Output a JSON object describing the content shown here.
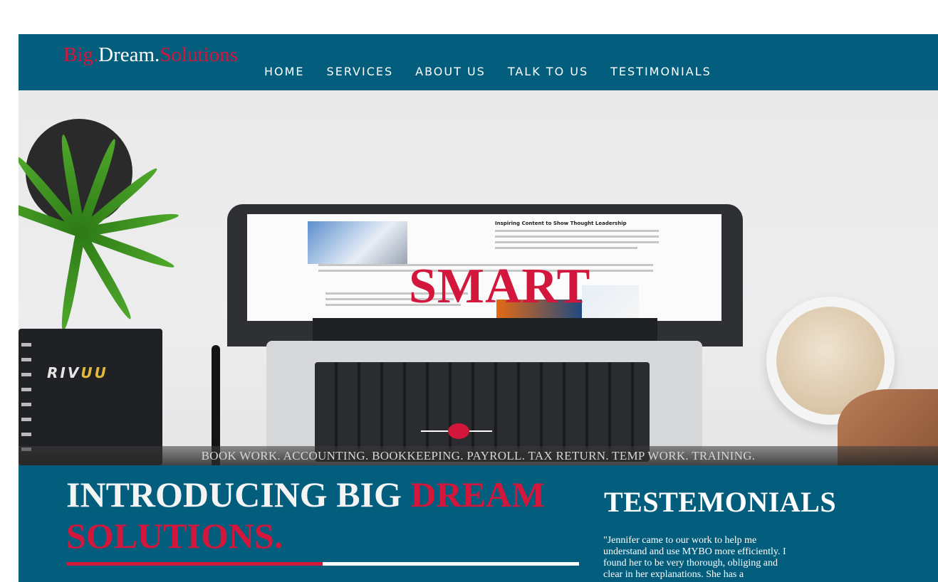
{
  "logo": {
    "part1": "Big.",
    "part2": "Dream.",
    "part3": "Solutions"
  },
  "nav": {
    "home": "HOME",
    "services": "SERVICES",
    "about": "ABOUT US",
    "talk": "TALK TO US",
    "testimonials": "TESTIMONIALS"
  },
  "hero": {
    "slide_word": "SMART",
    "screen_heading": "Inspiring Content to Show Thought Leadership",
    "notebook_brand_part1": "RIV",
    "notebook_brand_part2": "UU",
    "tagline": "BOOK WORK. ACCOUNTING. BOOKKEEPING. PAYROLL. TAX RETURN. TEMP WORK. TRAINING."
  },
  "intro": {
    "title_white": "INTRODUCING BIG ",
    "title_red": "DREAM SOLUTIONS."
  },
  "testimonials": {
    "title": "TESTEMONIALS",
    "quote": "\"Jennifer came to our work to help me understand and use MYBO more efficiently. I found her to be very thorough, obliging and clear in her explanations. She has a"
  },
  "colors": {
    "brand_blue": "#035e7e",
    "accent_red": "#d3163b"
  }
}
